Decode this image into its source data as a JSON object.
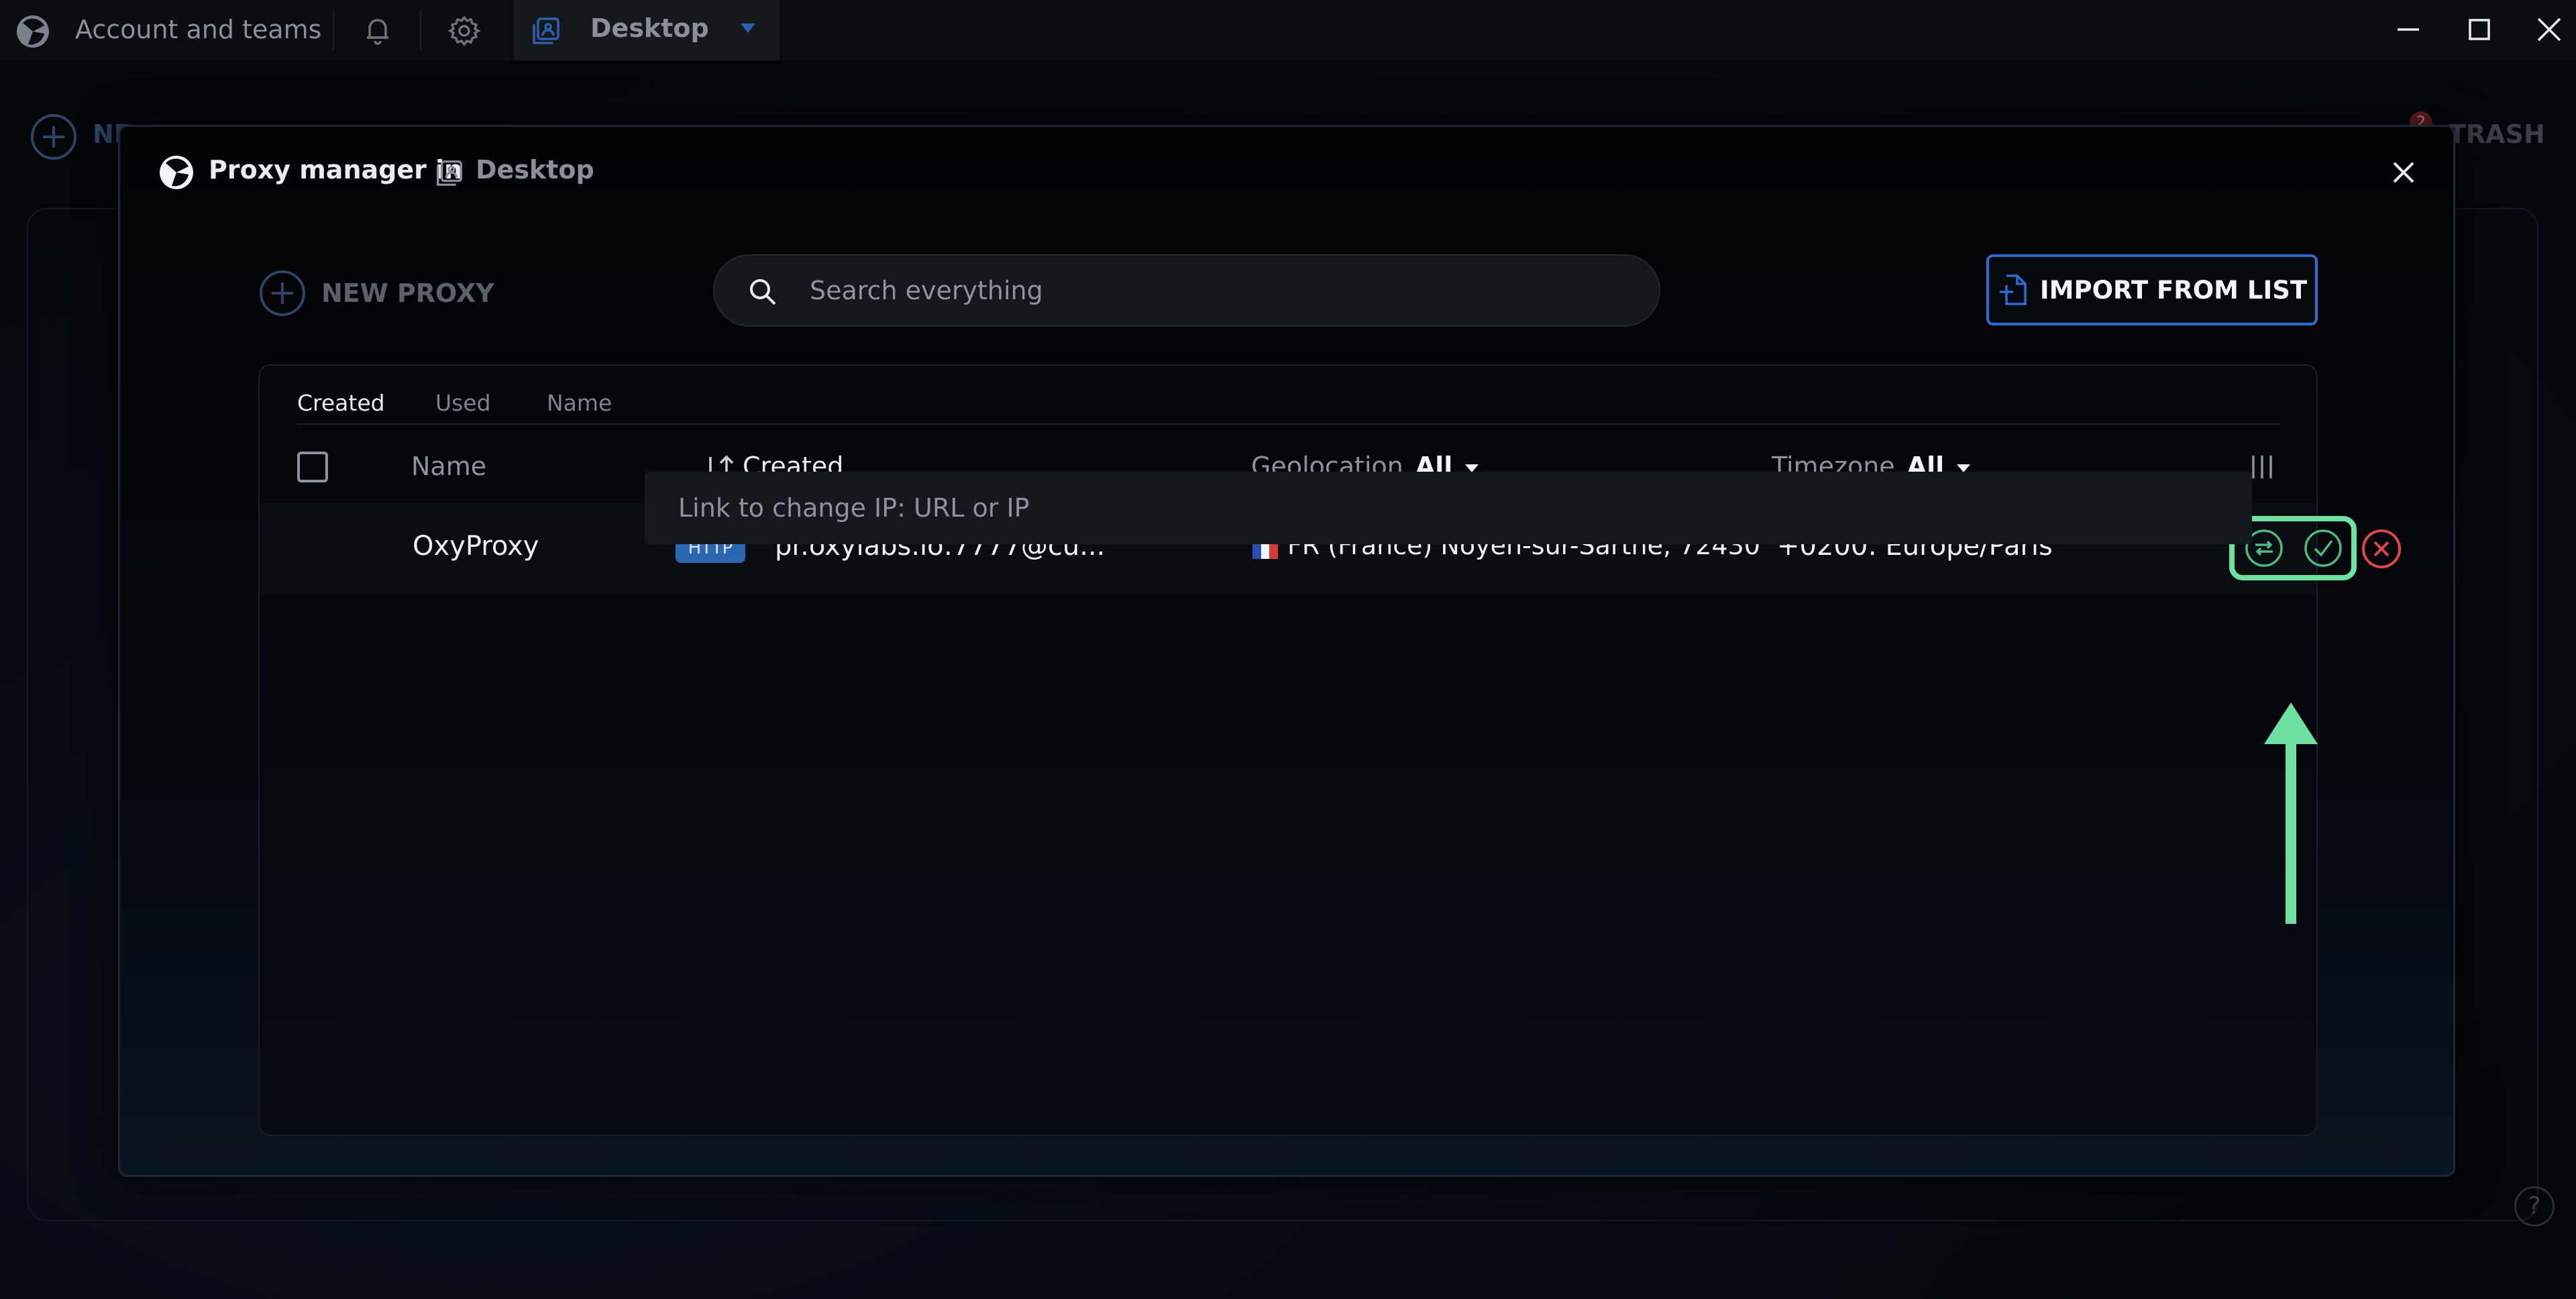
{
  "titlebar": {
    "account_label": "Account and teams",
    "workspace_name": "Desktop"
  },
  "background": {
    "new_label": "NE",
    "trash_label": "TRASH",
    "trash_badge": "2",
    "help_glyph": "?"
  },
  "modal": {
    "title": "Proxy manager in",
    "workspace_name": "Desktop",
    "new_proxy_label": "NEW PROXY",
    "search_placeholder": "Search everything",
    "import_label": "IMPORT FROM LIST",
    "sort_tabs": [
      {
        "label": "Created",
        "active": true
      },
      {
        "label": "Used",
        "active": false
      },
      {
        "label": "Name",
        "active": false
      }
    ],
    "columns": {
      "name": "Name",
      "created": "Created",
      "geolocation": "Geolocation",
      "geolocation_filter": "All",
      "timezone": "Timezone",
      "timezone_filter": "All"
    },
    "rows": [
      {
        "name": "OxyProxy",
        "protocol": "HTTP",
        "host": "pr.oxylabs.io:7777@cu...",
        "country_flag": "FR",
        "geolocation": "FR (France) Noyen-sur-Sarthe, 72430",
        "timezone": "+0200: Europe/Paris"
      }
    ],
    "link_placeholder": "Link to change IP: URL or IP"
  },
  "colors": {
    "accent_blue": "#2a6cd6",
    "highlight_green": "#6ee0a2",
    "delete_red": "#e0464f",
    "http_badge": "#2a67b0"
  },
  "icons": {
    "app_logo": "app-logo-icon",
    "bell": "bell-icon",
    "gear": "gear-icon",
    "workspace": "workspace-icon",
    "search": "search-icon",
    "import": "file-import-icon",
    "refresh": "refresh-icon",
    "check": "check-icon",
    "delete": "close-circle-icon",
    "columns": "columns-icon"
  }
}
